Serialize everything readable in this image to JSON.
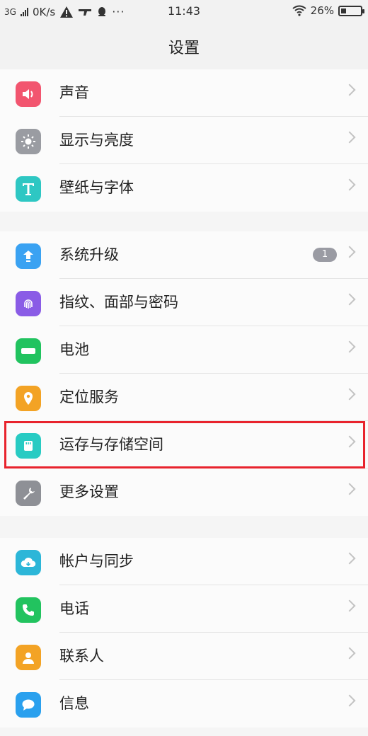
{
  "status_bar": {
    "network": "3G",
    "speed": "0K/s",
    "time": "11:43",
    "battery": "26%",
    "battery_level": 0.26,
    "icons": [
      "signal-icon",
      "warning-icon",
      "drone-icon",
      "qq-icon",
      "more-icon",
      "wifi-icon",
      "battery-icon"
    ]
  },
  "header": {
    "title": "设置"
  },
  "groups": [
    {
      "items": [
        {
          "label": "声音",
          "icon": "sound-icon",
          "color": "#f2556f"
        },
        {
          "label": "显示与亮度",
          "icon": "brightness-icon",
          "color": "#9a9ca2"
        },
        {
          "label": "壁纸与字体",
          "icon": "font-icon",
          "color": "#2ec7c3"
        }
      ]
    },
    {
      "items": [
        {
          "label": "系统升级",
          "icon": "upgrade-icon",
          "color": "#3aa2f2",
          "badge": "1"
        },
        {
          "label": "指纹、面部与密码",
          "icon": "fingerprint-icon",
          "color": "#8a5ce6"
        },
        {
          "label": "电池",
          "icon": "battery-setting-icon",
          "color": "#21c35f"
        },
        {
          "label": "定位服务",
          "icon": "location-icon",
          "color": "#f3a325"
        },
        {
          "label": "运存与存储空间",
          "icon": "storage-icon",
          "color": "#28cbc3",
          "highlighted": true
        },
        {
          "label": "更多设置",
          "icon": "wrench-icon",
          "color": "#8e9096"
        }
      ]
    },
    {
      "items": [
        {
          "label": "帐户与同步",
          "icon": "account-sync-icon",
          "color": "#2cb6d8"
        },
        {
          "label": "电话",
          "icon": "phone-icon",
          "color": "#22c35f"
        },
        {
          "label": "联系人",
          "icon": "contacts-icon",
          "color": "#f3a325"
        },
        {
          "label": "信息",
          "icon": "messages-icon",
          "color": "#2aa0ee"
        }
      ]
    }
  ],
  "highlight_color": "#e8232d"
}
